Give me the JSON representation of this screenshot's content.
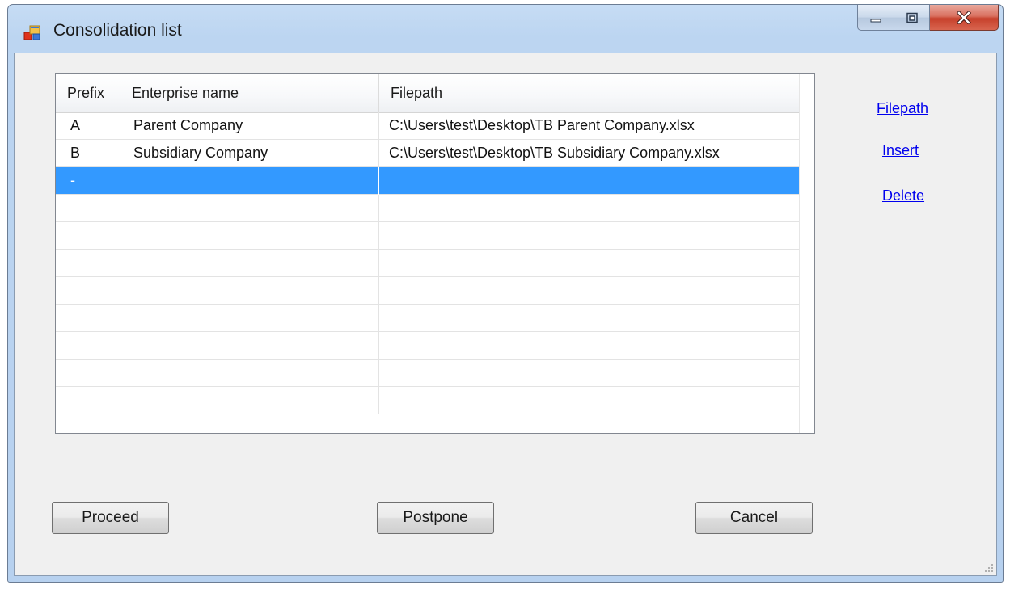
{
  "window": {
    "title": "Consolidation list"
  },
  "title_controls": {
    "minimize_icon": "minimize-icon",
    "maximize_icon": "maximize-icon",
    "close_icon": "close-icon"
  },
  "grid": {
    "columns": [
      "Prefix",
      "Enterprise name",
      "Filepath"
    ],
    "rows": [
      [
        "A",
        "Parent Company",
        "C:\\Users\\test\\Desktop\\TB Parent Company.xlsx"
      ],
      [
        "B",
        "Subsidiary Company",
        "C:\\Users\\test\\Desktop\\TB Subsidiary Company.xlsx"
      ],
      [
        "-",
        "",
        ""
      ]
    ],
    "selected_row": 2
  },
  "links": {
    "filepath": "Filepath",
    "insert": "Insert",
    "delete": "Delete"
  },
  "buttons": {
    "proceed": "Proceed",
    "postpone": "Postpone",
    "cancel": "Cancel"
  },
  "colors": {
    "selection": "#3399ff",
    "link": "#0000ee",
    "client_bg": "#f0f0f0"
  }
}
